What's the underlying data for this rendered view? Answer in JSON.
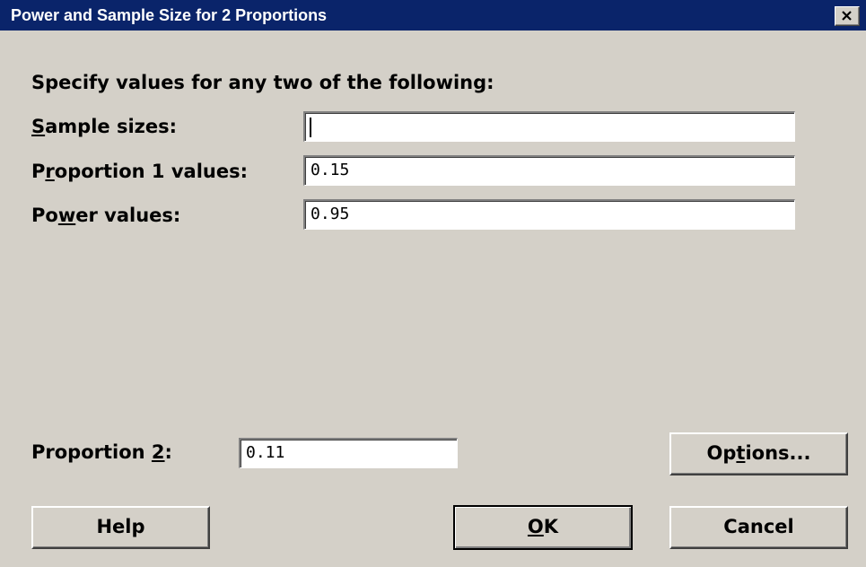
{
  "window": {
    "title": "Power and Sample Size for 2 Proportions",
    "close_icon": "close-icon"
  },
  "instructions": "Specify values for any two of the following:",
  "fields": {
    "sample_sizes": {
      "label_pre": "",
      "label_accel": "S",
      "label_post": "ample sizes:",
      "value": ""
    },
    "proportion1": {
      "label_pre": "P",
      "label_accel": "r",
      "label_post": "oportion 1 values:",
      "value": "0.15"
    },
    "power": {
      "label_pre": "Po",
      "label_accel": "w",
      "label_post": "er values:",
      "value": "0.95"
    },
    "proportion2": {
      "label_pre": "Proportion ",
      "label_accel": "2",
      "label_post": ":",
      "value": "0.11"
    }
  },
  "buttons": {
    "options": {
      "pre": "Op",
      "accel": "t",
      "post": "ions..."
    },
    "help": {
      "label": "Help"
    },
    "ok": {
      "pre": "",
      "accel": "O",
      "post": "K"
    },
    "cancel": {
      "label": "Cancel"
    }
  },
  "colors": {
    "titlebar": "#0a246a",
    "face": "#d4d0c8",
    "field": "#ffffff"
  }
}
